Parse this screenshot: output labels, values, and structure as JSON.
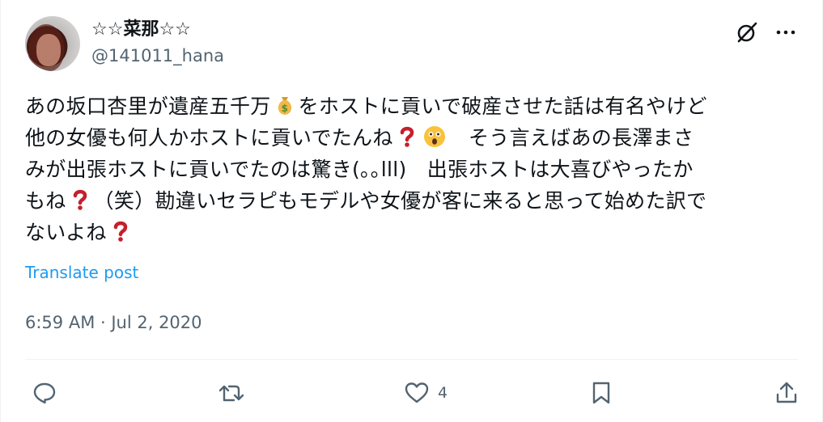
{
  "author": {
    "display_name": "☆☆菜那☆☆",
    "handle": "@141011_hana"
  },
  "post": {
    "line1_a": "あの坂口杏里が遺産五千万",
    "line1_b": "をホストに貢いで破産させた話は有名やけど",
    "line2_a": "他の女優も何人かホストに貢いでたんね",
    "line2_b": "　そう言えばあの長澤まさ",
    "line3": "みが出張ホストに貢いでたのは驚き(｡｡lll)　出張ホストは大喜びやったか",
    "line4_a": "もね",
    "line4_b": "（笑）勘違いセラピもモデルや女優が客に来ると思って始めた訳で",
    "line5_a": "ないよね",
    "translate_label": "Translate post",
    "timestamp": "6:59 AM · Jul 2, 2020"
  },
  "actions": {
    "reply_count": "",
    "repost_count": "",
    "like_count": "4"
  },
  "icons": {
    "grok": "grok-icon",
    "more": "more-icon",
    "money_bag": "money-bag-emoji",
    "question": "red-question-mark-emoji",
    "astonished": "astonished-face-emoji",
    "reply": "reply-icon",
    "repost": "repost-icon",
    "like": "heart-icon",
    "bookmark": "bookmark-icon",
    "share": "share-icon"
  },
  "colors": {
    "text": "#0f1419",
    "secondary": "#536471",
    "link": "#1d9bf0",
    "divider": "#eff3f4"
  }
}
